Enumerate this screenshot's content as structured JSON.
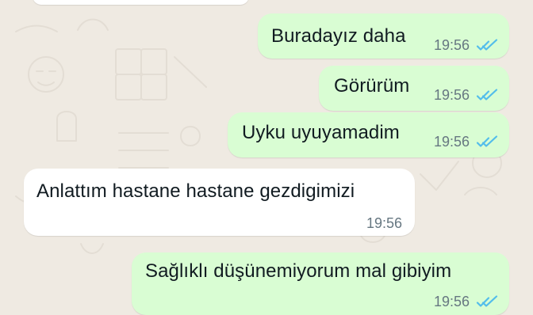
{
  "chat": {
    "messages": [
      {
        "direction": "outgoing",
        "text": "Buradayız daha",
        "time": "19:56",
        "status_icon": "double-check-icon",
        "status_color": "#53bdeb"
      },
      {
        "direction": "outgoing",
        "text": "Görürüm",
        "time": "19:56",
        "status_icon": "double-check-icon",
        "status_color": "#53bdeb"
      },
      {
        "direction": "outgoing",
        "text": "Uyku uyuyamadim",
        "time": "19:56",
        "status_icon": "double-check-icon",
        "status_color": "#53bdeb"
      },
      {
        "direction": "incoming",
        "text": "Anlattım hastane hastane gezdigimizi",
        "time": "19:56"
      },
      {
        "direction": "outgoing",
        "text": "Sağlıklı düşünemiyorum mal gibiyim",
        "time": "19:56",
        "status_icon": "double-check-icon",
        "status_color": "#53bdeb"
      }
    ]
  },
  "colors": {
    "wallpaper": "#efeae2",
    "outgoing_bubble": "#d9fdd3",
    "incoming_bubble": "#ffffff",
    "meta_text": "#667781",
    "read_ticks": "#53bdeb"
  }
}
